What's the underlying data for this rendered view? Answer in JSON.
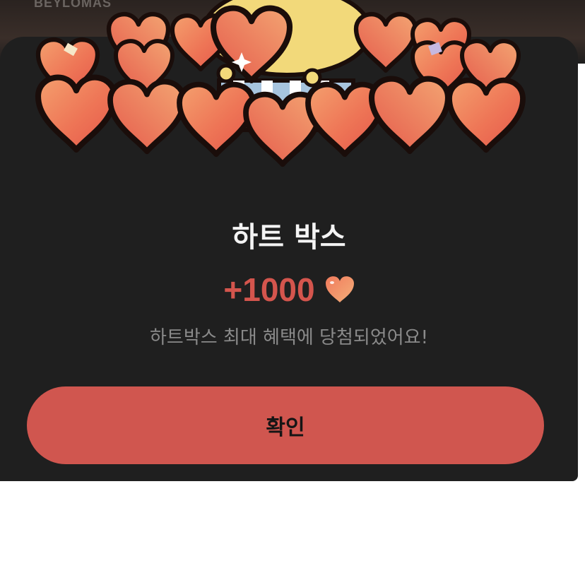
{
  "backdrop": {
    "logo_text": "BEYLOMAS"
  },
  "dialog": {
    "title": "하트 박스",
    "reward_amount": "+1000",
    "reward_icon": "heart-icon",
    "message": "하트박스 최대 혜택에 당첨되었어요!",
    "confirm_label": "확인"
  },
  "colors": {
    "sheet_background": "#1f1f1f",
    "accent": "#d0564f",
    "reward_text": "#d4554d",
    "title_text": "#f4f4f4",
    "message_text": "#8a8a8a",
    "page_background": "#ffffff"
  }
}
